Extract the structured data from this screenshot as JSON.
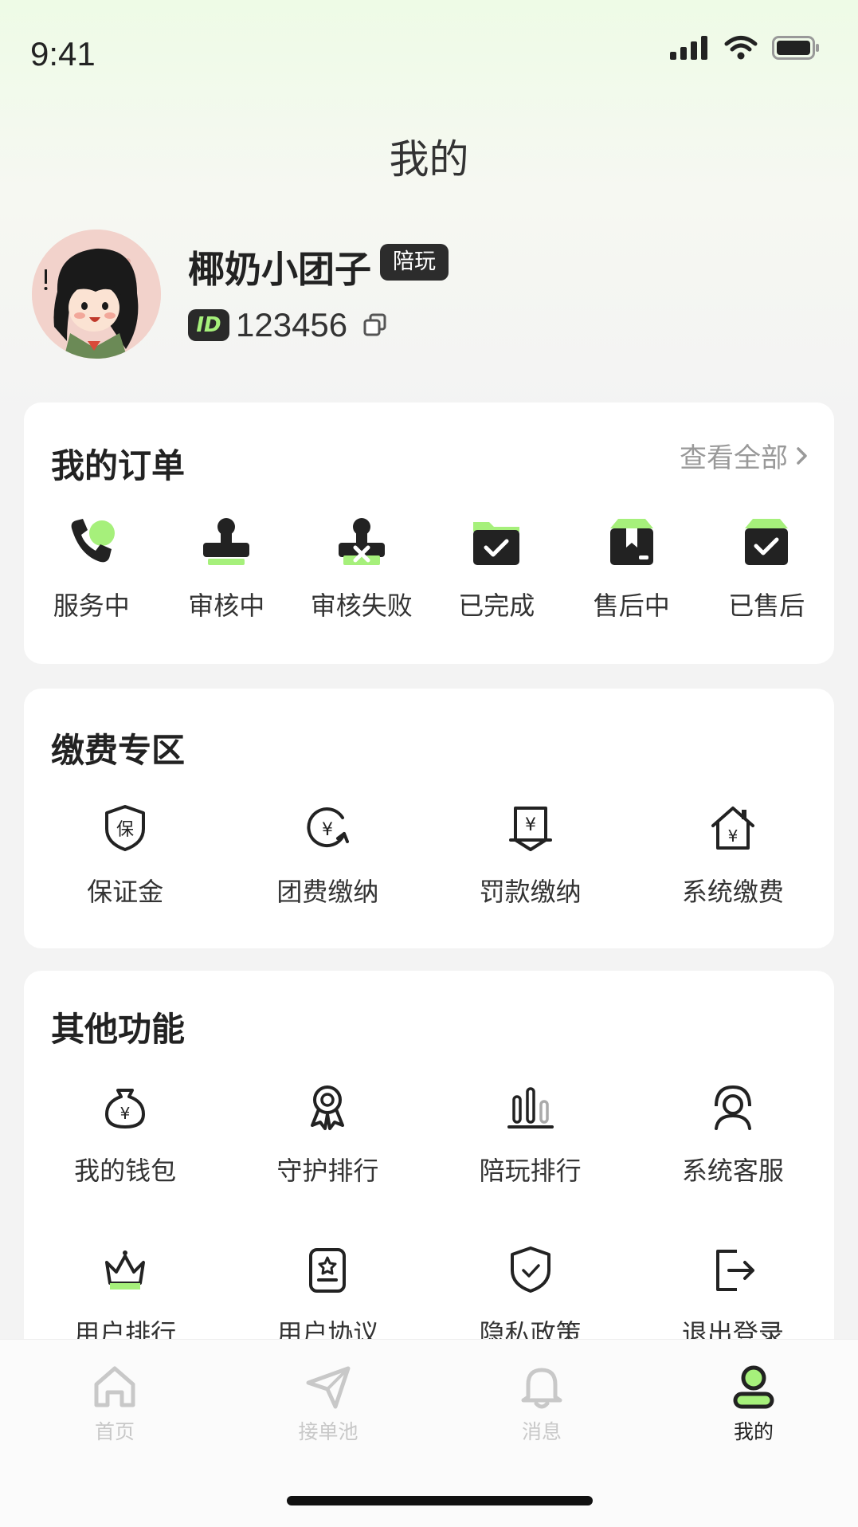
{
  "status_bar": {
    "time": "9:41"
  },
  "page_title": "我的",
  "profile": {
    "nickname": "椰奶小团子",
    "role_tag": "陪玩",
    "id_badge": "ID",
    "id_value": "123456"
  },
  "orders": {
    "title": "我的订单",
    "view_all": "查看全部",
    "items": [
      {
        "label": "服务中",
        "icon": "phone-icon"
      },
      {
        "label": "审核中",
        "icon": "review-pending-icon"
      },
      {
        "label": "审核失败",
        "icon": "review-failed-icon"
      },
      {
        "label": "已完成",
        "icon": "completed-icon"
      },
      {
        "label": "售后中",
        "icon": "after-sale-icon"
      },
      {
        "label": "已售后",
        "icon": "after-sale-done-icon"
      }
    ]
  },
  "payment": {
    "title": "缴费专区",
    "items": [
      {
        "label": "保证金",
        "icon": "deposit-shield-icon"
      },
      {
        "label": "团费缴纳",
        "icon": "team-fee-icon"
      },
      {
        "label": "罚款缴纳",
        "icon": "fine-icon"
      },
      {
        "label": "系统缴费",
        "icon": "system-fee-icon"
      }
    ]
  },
  "other": {
    "title": "其他功能",
    "row1": [
      {
        "label": "我的钱包",
        "icon": "wallet-icon"
      },
      {
        "label": "守护排行",
        "icon": "medal-icon"
      },
      {
        "label": "陪玩排行",
        "icon": "bar-chart-icon"
      },
      {
        "label": "系统客服",
        "icon": "headset-icon"
      }
    ],
    "row2": [
      {
        "label": "用户排行",
        "icon": "crown-icon"
      },
      {
        "label": "用户协议",
        "icon": "agreement-icon"
      },
      {
        "label": "隐私政策",
        "icon": "privacy-shield-icon"
      },
      {
        "label": "退出登录",
        "icon": "logout-icon"
      }
    ]
  },
  "tabbar": {
    "items": [
      {
        "label": "首页",
        "icon": "home-icon",
        "active": false
      },
      {
        "label": "接单池",
        "icon": "send-icon",
        "active": false
      },
      {
        "label": "消息",
        "icon": "bell-icon",
        "active": false
      },
      {
        "label": "我的",
        "icon": "user-icon",
        "active": true
      }
    ]
  },
  "colors": {
    "accent": "#a6f07b",
    "dark": "#222222",
    "inactive": "#c8c8c8"
  }
}
